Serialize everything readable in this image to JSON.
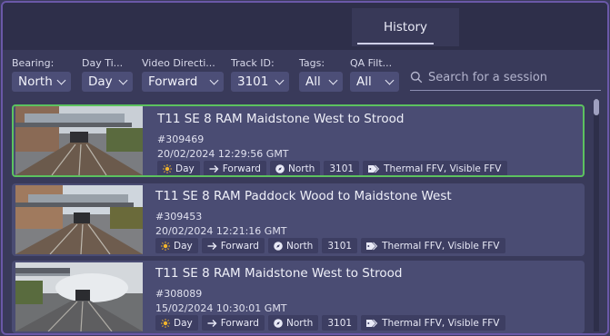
{
  "tabs": {
    "history": "History"
  },
  "filters": [
    {
      "label": "Bearing:",
      "value": "North"
    },
    {
      "label": "Day Ti...",
      "value": "Day"
    },
    {
      "label": "Video Directi...",
      "value": "Forward"
    },
    {
      "label": "Track ID:",
      "value": "3101"
    },
    {
      "label": "Tags:",
      "value": "All"
    },
    {
      "label": "QA Filt...",
      "value": "All"
    }
  ],
  "search": {
    "placeholder": "Search for a session"
  },
  "sessions": [
    {
      "title": "T11 SE 8 RAM Maidstone West to Strood",
      "id": "#309469",
      "datetime": "20/02/2024 12:29:56 GMT",
      "selected": true,
      "chips": {
        "daytime": "Day",
        "direction": "Forward",
        "bearing": "North",
        "track": "3101",
        "tags": "Thermal FFV, Visible FFV"
      }
    },
    {
      "title": "T11 SE 8 RAM Paddock Wood to Maidstone West",
      "id": "#309453",
      "datetime": "20/02/2024 12:21:16 GMT",
      "selected": false,
      "chips": {
        "daytime": "Day",
        "direction": "Forward",
        "bearing": "North",
        "track": "3101",
        "tags": "Thermal FFV, Visible FFV"
      }
    },
    {
      "title": "T11 SE 8 RAM Maidstone West to Strood",
      "id": "#308089",
      "datetime": "15/02/2024 10:30:01 GMT",
      "selected": false,
      "chips": {
        "daytime": "Day",
        "direction": "Forward",
        "bearing": "North",
        "track": "3101",
        "tags": "Thermal FFV, Visible FFV"
      }
    }
  ],
  "colors": {
    "selected_border": "#5cc25f",
    "chip_bg": "#3d3e62",
    "card_bg": "#4a4c73",
    "sun_icon": "#f2b52c"
  }
}
